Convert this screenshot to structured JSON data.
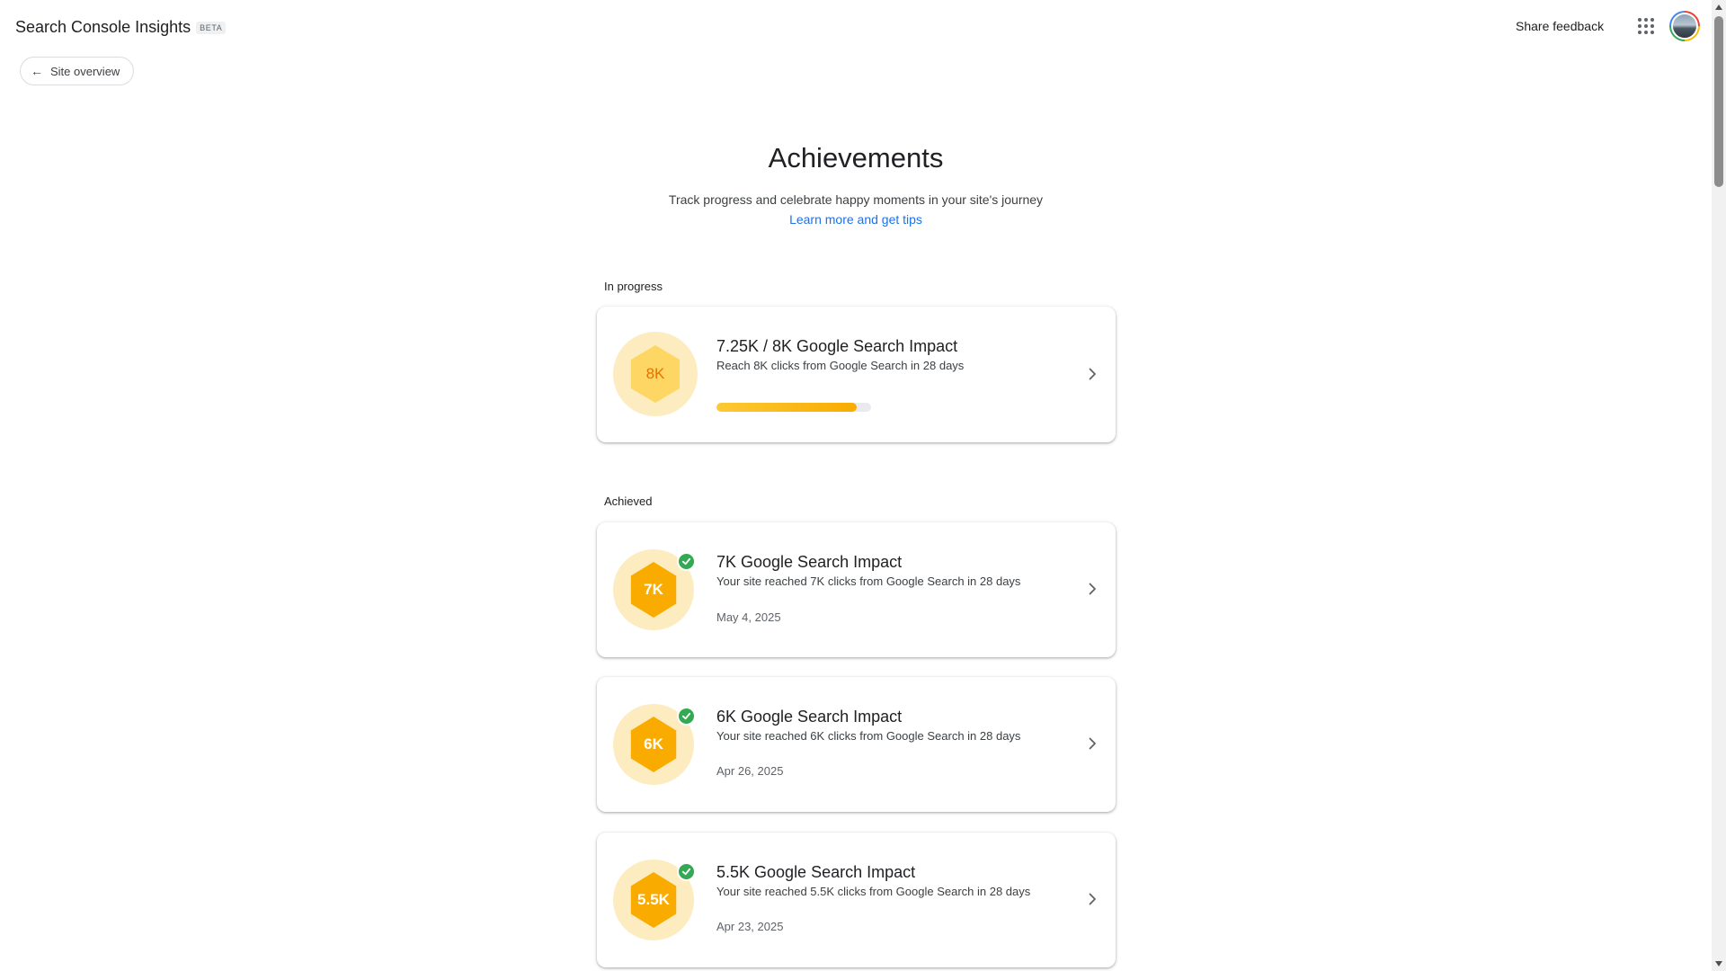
{
  "header": {
    "app_title": "Search Console Insights",
    "beta_label": "BETA",
    "share_feedback": "Share feedback",
    "apps_icon": "apps-grid-icon",
    "avatar_icon": "account-avatar"
  },
  "nav": {
    "back_label": "Site overview",
    "back_icon": "arrow-back-icon"
  },
  "hero": {
    "title": "Achievements",
    "subtitle": "Track progress and celebrate happy moments in your site's journey",
    "link": "Learn more and get tips"
  },
  "in_progress": {
    "label": "In progress",
    "items": [
      {
        "badge": "8K",
        "title": "7.25K / 8K Google Search Impact",
        "description": "Reach 8K clicks from Google Search in 28 days",
        "progress_percent": 90.6
      }
    ]
  },
  "achieved": {
    "label": "Achieved",
    "items": [
      {
        "badge": "7K",
        "title": "7K Google Search Impact",
        "description": "Your site reached 7K clicks from Google Search in 28 days",
        "date": "May 4, 2025"
      },
      {
        "badge": "6K",
        "title": "6K Google Search Impact",
        "description": "Your site reached 6K clicks from Google Search in 28 days",
        "date": "Apr 26, 2025"
      },
      {
        "badge": "5.5K",
        "title": "5.5K Google Search Impact",
        "description": "Your site reached 5.5K clicks from Google Search in 28 days",
        "date": "Apr 23, 2025"
      }
    ]
  },
  "colors": {
    "accent_link": "#1a73e8",
    "badge_gold": "#f9ab00",
    "badge_pending": "#fdd663",
    "badge_halo": "#fdecc0",
    "check_green": "#34a853"
  }
}
